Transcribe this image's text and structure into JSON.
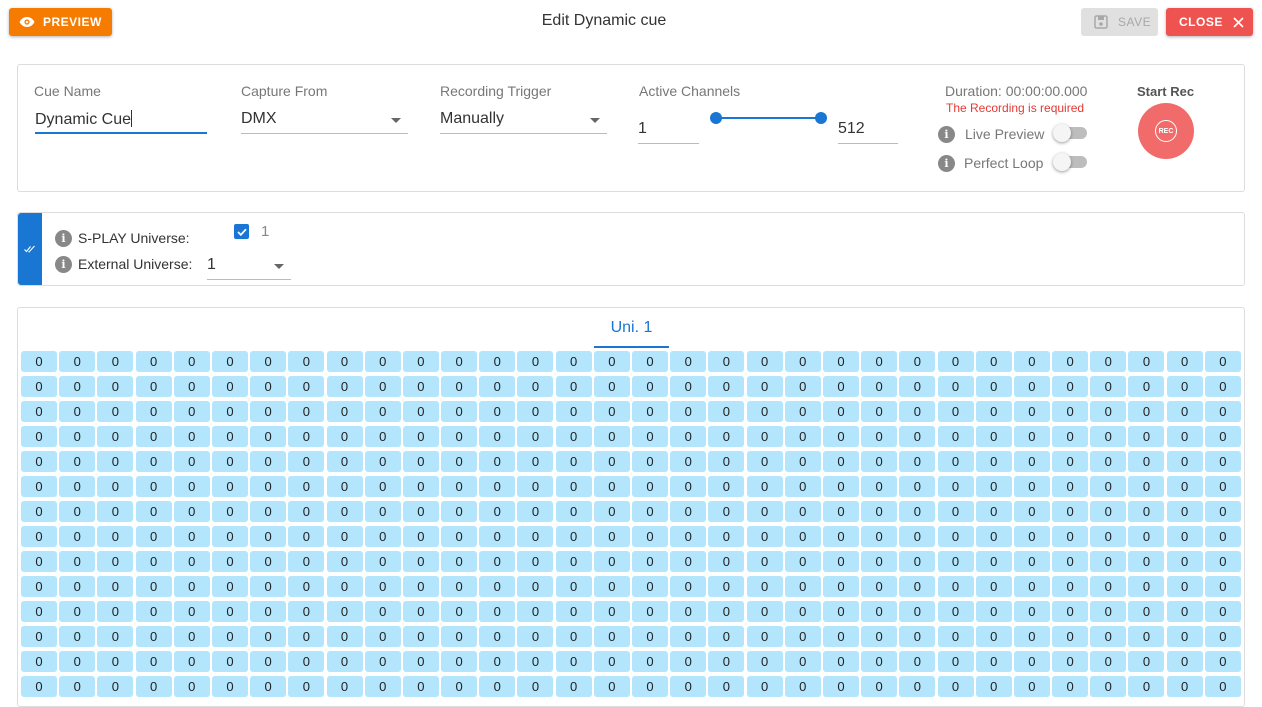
{
  "header": {
    "preview_label": "PREVIEW",
    "title": "Edit Dynamic cue",
    "save_label": "SAVE",
    "close_label": "CLOSE"
  },
  "settings": {
    "cue_name_label": "Cue Name",
    "cue_name_value": "Dynamic Cue",
    "capture_from_label": "Capture From",
    "capture_from_value": "DMX",
    "recording_trigger_label": "Recording Trigger",
    "recording_trigger_value": "Manually",
    "active_channels_label": "Active Channels",
    "active_channels_from": "1",
    "active_channels_to": "512",
    "active_channels_range": [
      1,
      512
    ],
    "duration_label": "Duration: 00:00:00.000",
    "error_text": "The Recording is required",
    "live_preview_label": "Live Preview",
    "live_preview_on": false,
    "perfect_loop_label": "Perfect Loop",
    "perfect_loop_on": false,
    "start_rec_label": "Start Rec",
    "rec_label": "REC"
  },
  "universe": {
    "splay_label": "S-PLAY Universe:",
    "splay_checked": true,
    "splay_value": "1",
    "external_label": "External Universe:",
    "external_value": "1"
  },
  "channels": {
    "tab_label": "Uni. 1",
    "columns": 32,
    "visible_rows": 14,
    "cell_value": "0"
  },
  "colors": {
    "preview": "#f57c00",
    "close": "#ef5350",
    "accent": "#1976d2",
    "rec": "#f26b6b",
    "cell": "#b3e5fc",
    "error": "#e53935"
  },
  "icons": {
    "preview": "eye-icon",
    "save": "floppy-disk-icon",
    "close": "close-icon",
    "side_tab": "double-check-icon",
    "info": "info-icon"
  }
}
